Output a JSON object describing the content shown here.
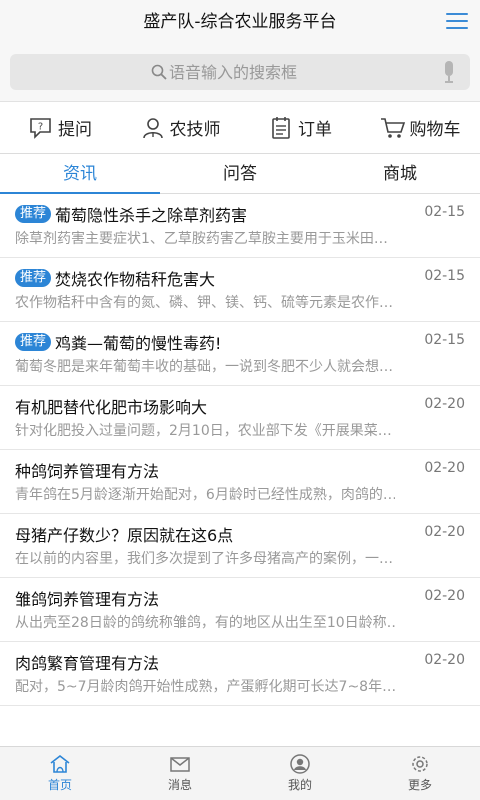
{
  "header": {
    "title": "盛产队-综合农业服务平台"
  },
  "search": {
    "placeholder": "语音输入的搜索框"
  },
  "quick_nav": [
    {
      "label": "提问",
      "icon": "question-icon"
    },
    {
      "label": "农技师",
      "icon": "expert-icon"
    },
    {
      "label": "订单",
      "icon": "order-icon"
    },
    {
      "label": "购物车",
      "icon": "cart-icon"
    }
  ],
  "tabs": [
    {
      "label": "资讯",
      "active": true
    },
    {
      "label": "问答",
      "active": false
    },
    {
      "label": "商城",
      "active": false
    }
  ],
  "news": [
    {
      "badge": "推荐",
      "title": "葡萄隐性杀手之除草剂药害",
      "date": "02-15",
      "summary": "除草剂药害主要症状1、乙草胺药害乙草胺主要用于玉米田…"
    },
    {
      "badge": "推荐",
      "title": "焚烧农作物秸秆危害大",
      "date": "02-15",
      "summary": "农作物秸秆中含有的氮、磷、钾、镁、钙、硫等元素是农作…"
    },
    {
      "badge": "推荐",
      "title": "鸡粪—葡萄的慢性毒药!",
      "date": "02-15",
      "summary": "葡萄冬肥是来年葡萄丰收的基础，一说到冬肥不少人就会想…"
    },
    {
      "badge": "",
      "title": "有机肥替代化肥市场影响大",
      "date": "02-20",
      "summary": "针对化肥投入过量问题，2月10日，农业部下发《开展果菜…"
    },
    {
      "badge": "",
      "title": "种鸽饲养管理有方法",
      "date": "02-20",
      "summary": "青年鸽在5月龄逐渐开始配对，6月龄时已经性成熟，肉鸽的…"
    },
    {
      "badge": "",
      "title": "母猪产仔数少？原因就在这6点",
      "date": "02-20",
      "summary": "在以前的内容里，我们多次提到了许多母猪高产的案例，一…"
    },
    {
      "badge": "",
      "title": "雏鸽饲养管理有方法",
      "date": "02-20",
      "summary": "从出壳至28日龄的鸽统称雏鸽，有的地区从出生至10日龄称…"
    },
    {
      "badge": "",
      "title": "肉鸽繁育管理有方法",
      "date": "02-20",
      "summary": "配对，5~7月龄肉鸽开始性成熟，产蛋孵化期可长达7~8年…"
    }
  ],
  "bottom_nav": [
    {
      "label": "首页",
      "icon": "home-icon",
      "active": true
    },
    {
      "label": "消息",
      "icon": "mail-icon",
      "active": false
    },
    {
      "label": "我的",
      "icon": "user-icon",
      "active": false
    },
    {
      "label": "更多",
      "icon": "gear-icon",
      "active": false
    }
  ],
  "colors": {
    "accent": "#2c85d6",
    "header_bg": "#f7f7f7"
  }
}
